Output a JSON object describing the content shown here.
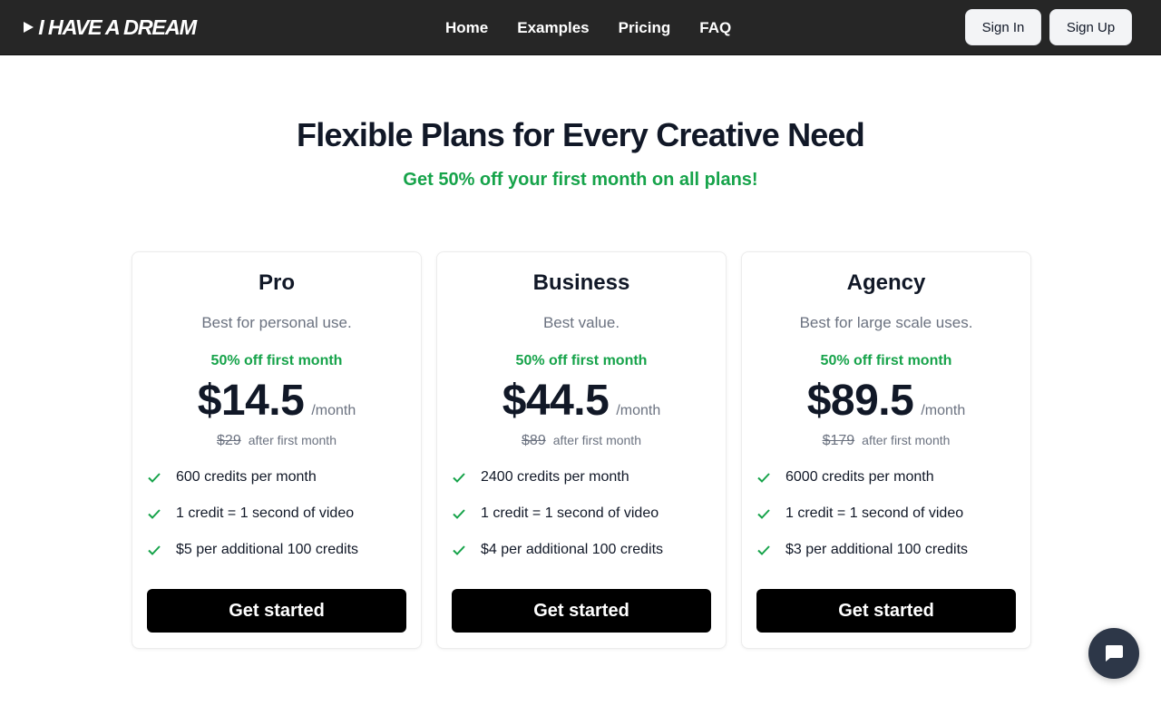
{
  "header": {
    "logo_text": "I HAVE A DREAM",
    "logo_icon": "play-icon",
    "nav": [
      {
        "label": "Home"
      },
      {
        "label": "Examples"
      },
      {
        "label": "Pricing"
      },
      {
        "label": "FAQ"
      }
    ],
    "sign_in_label": "Sign In",
    "sign_up_label": "Sign Up"
  },
  "hero": {
    "title": "Flexible Plans for Every Creative Need",
    "subtitle": "Get 50% off your first month on all plans!"
  },
  "plans": [
    {
      "name": "Pro",
      "description": "Best for personal use.",
      "discount": "50% off first month",
      "price": "$14.5",
      "period": "/month",
      "original_price": "$29",
      "after_label": "after first month",
      "features": [
        "600 credits per month",
        "1 credit = 1 second of video",
        "$5 per additional 100 credits"
      ],
      "cta": "Get started"
    },
    {
      "name": "Business",
      "description": "Best value.",
      "discount": "50% off first month",
      "price": "$44.5",
      "period": "/month",
      "original_price": "$89",
      "after_label": "after first month",
      "features": [
        "2400 credits per month",
        "1 credit = 1 second of video",
        "$4 per additional 100 credits"
      ],
      "cta": "Get started"
    },
    {
      "name": "Agency",
      "description": "Best for large scale uses.",
      "discount": "50% off first month",
      "price": "$89.5",
      "period": "/month",
      "original_price": "$179",
      "after_label": "after first month",
      "features": [
        "6000 credits per month",
        "1 credit = 1 second of video",
        "$3 per additional 100 credits"
      ],
      "cta": "Get started"
    }
  ],
  "chat": {
    "icon": "chat-bubble-icon"
  },
  "colors": {
    "header_bg": "#262626",
    "accent_green": "#16a34a",
    "cta_bg": "#000000",
    "chat_bg": "#2d3748"
  }
}
